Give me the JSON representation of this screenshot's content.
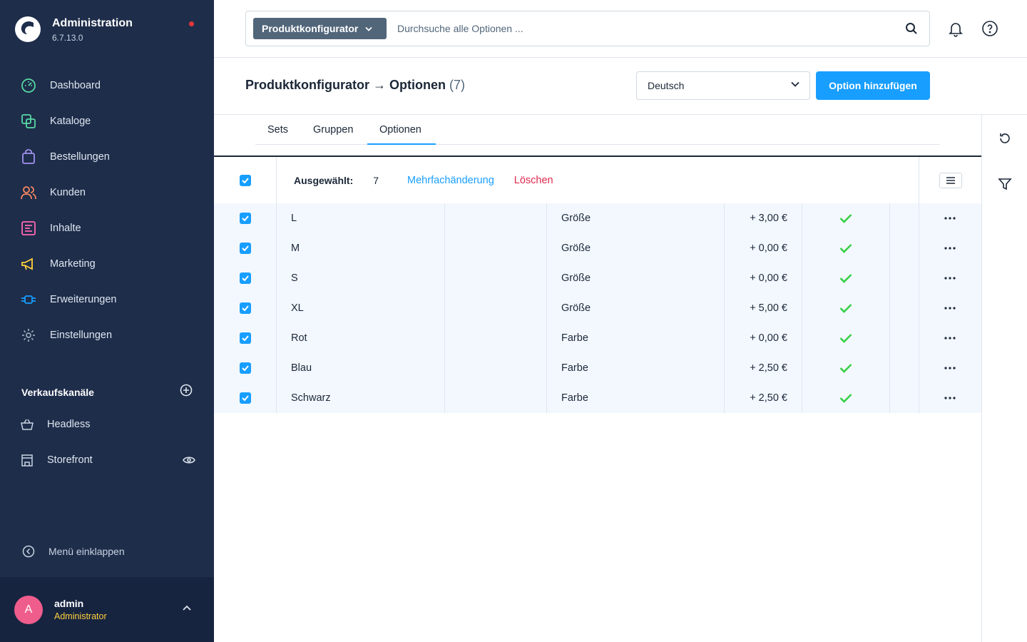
{
  "sidebar": {
    "title": "Administration",
    "version": "6.7.13.0",
    "nav": [
      {
        "label": "Dashboard",
        "icon": "dashboard-icon",
        "color": "#57d9a3"
      },
      {
        "label": "Kataloge",
        "icon": "catalog-icon",
        "color": "#57d9a3"
      },
      {
        "label": "Bestellungen",
        "icon": "orders-icon",
        "color": "#a092f0"
      },
      {
        "label": "Kunden",
        "icon": "customers-icon",
        "color": "#f88962"
      },
      {
        "label": "Inhalte",
        "icon": "content-icon",
        "color": "#ff68b4"
      },
      {
        "label": "Marketing",
        "icon": "marketing-icon",
        "color": "#ffd03a"
      },
      {
        "label": "Erweiterungen",
        "icon": "extensions-icon",
        "color": "#189eff"
      },
      {
        "label": "Einstellungen",
        "icon": "settings-icon",
        "color": "#9aa8b5"
      }
    ],
    "channels_title": "Verkaufskanäle",
    "channels": [
      {
        "label": "Headless",
        "icon": "basket-icon"
      },
      {
        "label": "Storefront",
        "icon": "storefront-icon"
      }
    ],
    "collapse_label": "Menü einklappen",
    "user": {
      "initial": "A",
      "name": "admin",
      "role": "Administrator"
    }
  },
  "topbar": {
    "search_type": "Produktkonfigurator",
    "search_placeholder": "Durchsuche alle Optionen ..."
  },
  "smartbar": {
    "title": "Produktkonfigurator → Optionen",
    "count": "(7)",
    "language": "Deutsch",
    "add_button": "Option hinzufügen"
  },
  "tabs": [
    "Sets",
    "Gruppen",
    "Optionen"
  ],
  "active_tab": "Optionen",
  "bulk": {
    "label": "Ausgewählt:",
    "count": "7",
    "edit": "Mehrfachänderung",
    "delete": "Löschen"
  },
  "rows": [
    {
      "name": "L",
      "group": "Größe",
      "price": "+ 3,00 €",
      "active": true
    },
    {
      "name": "M",
      "group": "Größe",
      "price": "+ 0,00 €",
      "active": true
    },
    {
      "name": "S",
      "group": "Größe",
      "price": "+ 0,00 €",
      "active": true
    },
    {
      "name": "XL",
      "group": "Größe",
      "price": "+ 5,00 €",
      "active": true
    },
    {
      "name": "Rot",
      "group": "Farbe",
      "price": "+ 0,00 €",
      "active": true
    },
    {
      "name": "Blau",
      "group": "Farbe",
      "price": "+ 2,50 €",
      "active": true
    },
    {
      "name": "Schwarz",
      "group": "Farbe",
      "price": "+ 2,50 €",
      "active": true
    }
  ],
  "colors": {
    "primary": "#189eff",
    "sidebar_bg": "#1e2d4a",
    "danger": "#de294c",
    "success": "#37d046",
    "row_selected": "#f3f8ff"
  }
}
